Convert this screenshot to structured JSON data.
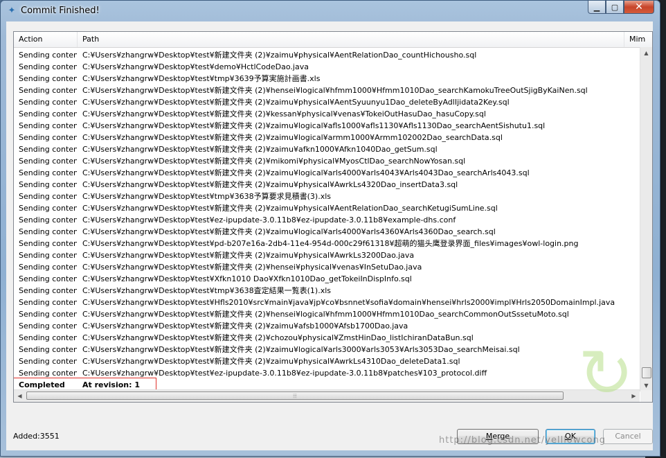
{
  "window": {
    "title": "Commit Finished!",
    "icons": {
      "app": "tortoise-svn-icon",
      "minimize": "minimize-icon",
      "maximize": "maximize-icon",
      "close": "close-icon"
    }
  },
  "list": {
    "columns": [
      "Action",
      "Path",
      "Mim"
    ],
    "rows": [
      {
        "action": "Sending content",
        "path": "C:¥Users¥zhangrw¥Desktop¥test¥新建文件夹 (2)¥zaimu¥physical¥AentRelationDao_countHichousho.sql"
      },
      {
        "action": "Sending content",
        "path": "C:¥Users¥zhangrw¥Desktop¥test¥demo¥HctlCodeDao.java"
      },
      {
        "action": "Sending content",
        "path": "C:¥Users¥zhangrw¥Desktop¥test¥tmp¥3639予算実施計画書.xls"
      },
      {
        "action": "Sending content",
        "path": "C:¥Users¥zhangrw¥Desktop¥test¥新建文件夹 (2)¥hensei¥logical¥hfmm1000¥Hfmm1010Dao_searchKamokuTreeOutSjigByKaiNen.sql"
      },
      {
        "action": "Sending content",
        "path": "C:¥Users¥zhangrw¥Desktop¥test¥新建文件夹 (2)¥zaimu¥physical¥AentSyuunyu1Dao_deleteByAdlIjidata2Key.sql"
      },
      {
        "action": "Sending content",
        "path": "C:¥Users¥zhangrw¥Desktop¥test¥新建文件夹 (2)¥kessan¥physical¥venas¥TokeiOutHasuDao_hasuCopy.sql"
      },
      {
        "action": "Sending content",
        "path": "C:¥Users¥zhangrw¥Desktop¥test¥新建文件夹 (2)¥zaimu¥logical¥afls1000¥afls1130¥Afls1130Dao_searchAentSishutu1.sql"
      },
      {
        "action": "Sending content",
        "path": "C:¥Users¥zhangrw¥Desktop¥test¥新建文件夹 (2)¥zaimu¥logical¥armm1000¥Armm102002Dao_searchData.sql"
      },
      {
        "action": "Sending content",
        "path": "C:¥Users¥zhangrw¥Desktop¥test¥新建文件夹 (2)¥zaimu¥afkn1000¥Afkn1040Dao_getSum.sql"
      },
      {
        "action": "Sending content",
        "path": "C:¥Users¥zhangrw¥Desktop¥test¥新建文件夹 (2)¥mikomi¥physical¥MyosCtlDao_searchNowYosan.sql"
      },
      {
        "action": "Sending content",
        "path": "C:¥Users¥zhangrw¥Desktop¥test¥新建文件夹 (2)¥zaimu¥logical¥arls4000¥arls4043¥Arls4043Dao_searchArls4043.sql"
      },
      {
        "action": "Sending content",
        "path": "C:¥Users¥zhangrw¥Desktop¥test¥新建文件夹 (2)¥zaimu¥physical¥AwrkLs4320Dao_insertData3.sql"
      },
      {
        "action": "Sending content",
        "path": "C:¥Users¥zhangrw¥Desktop¥test¥tmp¥3638予算要求見積書(3).xls"
      },
      {
        "action": "Sending content",
        "path": "C:¥Users¥zhangrw¥Desktop¥test¥新建文件夹 (2)¥zaimu¥physical¥AentRelationDao_searchKetugiSumLine.sql"
      },
      {
        "action": "Sending content",
        "path": "C:¥Users¥zhangrw¥Desktop¥test¥ez-ipupdate-3.0.11b8¥ez-ipupdate-3.0.11b8¥example-dhs.conf"
      },
      {
        "action": "Sending content",
        "path": "C:¥Users¥zhangrw¥Desktop¥test¥新建文件夹 (2)¥zaimu¥logical¥arls4000¥arls4360¥Arls4360Dao_search.sql"
      },
      {
        "action": "Sending content",
        "path": "C:¥Users¥zhangrw¥Desktop¥test¥pd-b207e16a-2db4-11e4-954d-000c29f61318¥超萌的猫头鹰登录界面_files¥images¥owl-login.png"
      },
      {
        "action": "Sending content",
        "path": "C:¥Users¥zhangrw¥Desktop¥test¥新建文件夹 (2)¥zaimu¥physical¥AwrkLs3200Dao.java"
      },
      {
        "action": "Sending content",
        "path": "C:¥Users¥zhangrw¥Desktop¥test¥新建文件夹 (2)¥hensei¥physical¥venas¥InSetuDao.java"
      },
      {
        "action": "Sending content",
        "path": "C:¥Users¥zhangrw¥Desktop¥test¥Xfkn1010 Dao¥Xfkn1010Dao_getTokeiInDispInfo.sql"
      },
      {
        "action": "Sending content",
        "path": "C:¥Users¥zhangrw¥Desktop¥test¥tmp¥3638査定結果一覧表(1).xls"
      },
      {
        "action": "Sending content",
        "path": "C:¥Users¥zhangrw¥Desktop¥test¥Hfls2010¥src¥main¥java¥jp¥co¥bsnnet¥sofia¥domain¥hensei¥hrls2000¥impl¥Hrls2050DomainImpl.java"
      },
      {
        "action": "Sending content",
        "path": "C:¥Users¥zhangrw¥Desktop¥test¥新建文件夹 (2)¥hensei¥logical¥hfmm1000¥Hfmm1010Dao_searchCommonOutSssetuMoto.sql"
      },
      {
        "action": "Sending content",
        "path": "C:¥Users¥zhangrw¥Desktop¥test¥新建文件夹 (2)¥zaimu¥afsb1000¥Afsb1700Dao.java"
      },
      {
        "action": "Sending content",
        "path": "C:¥Users¥zhangrw¥Desktop¥test¥新建文件夹 (2)¥chozou¥physical¥ZmstHinDao_listIchiranDataBun.sql"
      },
      {
        "action": "Sending content",
        "path": "C:¥Users¥zhangrw¥Desktop¥test¥新建文件夹 (2)¥zaimu¥logical¥arls3000¥arls3053¥Arls3053Dao_searchMeisai.sql"
      },
      {
        "action": "Sending content",
        "path": "C:¥Users¥zhangrw¥Desktop¥test¥新建文件夹 (2)¥zaimu¥physical¥AwrkLs4310Dao_deleteData1.sql"
      },
      {
        "action": "Sending content",
        "path": "C:¥Users¥zhangrw¥Desktop¥test¥ez-ipupdate-3.0.11b8¥ez-ipupdate-3.0.11b8¥patches¥103_protocol.diff"
      }
    ],
    "completed": {
      "action": "Completed",
      "path": "At revision: 1"
    },
    "highlight_color": "#e0302a"
  },
  "status": {
    "added": "Added:3551"
  },
  "buttons": {
    "merge": {
      "pre": "",
      "mn": "M",
      "post": "erge"
    },
    "ok": {
      "pre": "",
      "mn": "O",
      "post": "K"
    },
    "cancel": {
      "pre": "",
      "mn": "",
      "post": "Cancel"
    }
  },
  "watermark": "http://blog.csdn.net/yelllowcong"
}
